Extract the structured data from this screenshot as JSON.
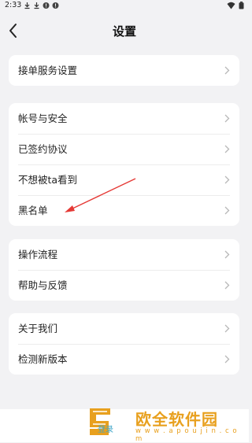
{
  "status_bar": {
    "time": "2:33",
    "left_icons": [
      "download-icon",
      "download-icon",
      "alert-icon",
      "alert-icon"
    ],
    "right_icons": [
      "wifi-icon",
      "battery-icon"
    ]
  },
  "nav": {
    "back_icon": "chevron-left-icon",
    "title": "设置"
  },
  "groups": [
    {
      "items": [
        {
          "label": "接单服务设置"
        }
      ]
    },
    {
      "items": [
        {
          "label": "帐号与安全"
        },
        {
          "label": "已签约协议"
        },
        {
          "label": "不想被ta看到"
        },
        {
          "label": "黑名单"
        }
      ]
    },
    {
      "items": [
        {
          "label": "操作流程"
        },
        {
          "label": "帮助与反馈"
        }
      ]
    },
    {
      "items": [
        {
          "label": "关于我们"
        },
        {
          "label": "检测新版本"
        }
      ]
    }
  ],
  "annotation": {
    "color": "#e53935"
  },
  "watermark": {
    "title": "欧全软件园",
    "url": "w w w . a p o u j i n . c o m",
    "login_text": "登录",
    "color": "#e8a01e"
  },
  "colors": {
    "background": "#f2f2f4",
    "card": "#ffffff",
    "text": "#222222",
    "chevron": "#b8b8b8"
  }
}
